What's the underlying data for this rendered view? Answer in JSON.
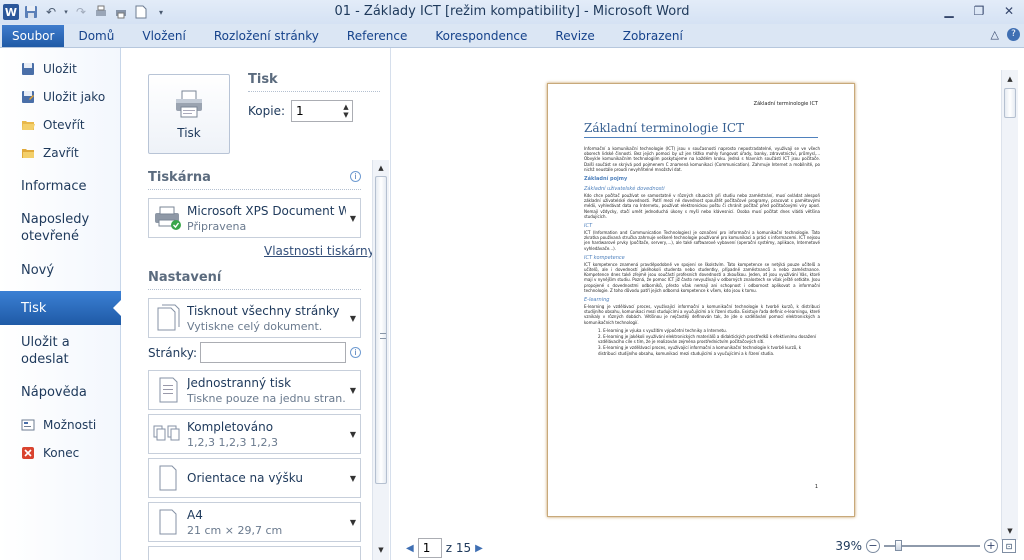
{
  "window": {
    "title": "01 - Základy ICT [režim kompatibility]  -  Microsoft Word",
    "app_icon_letter": "W"
  },
  "ribbon_tabs": [
    "Soubor",
    "Domů",
    "Vložení",
    "Rozložení stránky",
    "Reference",
    "Korespondence",
    "Revize",
    "Zobrazení"
  ],
  "nav": {
    "save": "Uložit",
    "save_as": "Uložit jako",
    "open": "Otevřít",
    "close": "Zavřít",
    "info": "Informace",
    "recent": "Naposledy otevřené",
    "new": "Nový",
    "print": "Tisk",
    "save_send": "Uložit a odeslat",
    "help": "Nápověda",
    "options": "Možnosti",
    "exit": "Konec"
  },
  "print": {
    "section_title": "Tisk",
    "button_label": "Tisk",
    "copies_label": "Kopie:",
    "copies_value": "1"
  },
  "printer": {
    "section_title": "Tiskárna",
    "name": "Microsoft XPS Document W...",
    "status": "Připravena",
    "properties_link": "Vlastnosti tiskárny"
  },
  "settings": {
    "section_title": "Nastavení",
    "pages_label": "Stránky:",
    "pages_value": "",
    "items": [
      {
        "line1": "Tisknout všechny stránky",
        "line2": "Vytiskne celý dokument."
      },
      {
        "line1": "Jednostranný tisk",
        "line2": "Tiskne pouze na jednu stran..."
      },
      {
        "line1": "Kompletováno",
        "line2": "1,2,3    1,2,3    1,2,3"
      },
      {
        "line1": "Orientace na výšku",
        "line2": ""
      },
      {
        "line1": "A4",
        "line2": "21 cm × 29,7 cm"
      }
    ]
  },
  "preview_page": {
    "header": "Základní terminologie ICT",
    "title": "Základní terminologie ICT",
    "intro": "Informační a komunikační technologie (ICT) jsou v současnosti naprosto nepostradatelné, využívají se ve všech oborech lidské činnosti. Bez jejich pomoci by už jen těžko mohly fungovat úřady, banky, zdravotnictví, průmysl,... Obvykle komunikačním technologiím poskytujeme na každém kroku. Jedná s hlavních součástí ICT jsou počítače. Další součást se skrývá pod pojmenem C znamená komunikaci (Communication). Zahrnuje Internet a mobilnítě, po nichž neustále proudí nevyhřitelné množství dat.",
    "h_terms": "Základní pojmy",
    "h_skill": "Základní uživatelské dovednosti",
    "p_skill": "Kdo chce počítač používat se samostatně v různých situacích při studiu nebo zaměstnání, musí ovládat alespoň základní uživatelské dovednosti. Patří mezi ně dovednost spouštět počítačové programy, pracovat s pamětovými médii, vyhledávat data na Internetu, používat elektronickou poštu či chránit počítač před počítačovými viry apod. Nemají vždycky, stačí umět jednoduchá úkony s myší nebo klávesnicí. Osoba musí počítat dnes vládá většina studujících.",
    "h_ict": "ICT",
    "p_ict": "ICT (Information and Communication Technologies) je označení pro informační a komunikační technologie. Tato zkratka používaná stručka zahrnuje veškeré technologie používané pro komunikaci a práci s informacemi. ICT nejsou jen hardwarové prvky (počítače, servery,...), ale také softwarové vybavení (operační systémy, aplikace, Internetové vyhledávače...).",
    "h_comp": "ICT kompetence",
    "p_comp": "ICT kompetence znamená pravděpodobně ve spojení se školstvím. Tato kompetence se netýká pouze učitelů a učitelů, ale i dovedností jakéhokoli studenta nebo studentky, případně zaměstnanců a nebo zaměstnance. Kompetence dnes také zřejmě jsou součástí profesních dovedností a zkouškou. Jeden, ať jsou využívání Vás, ktoré mají v nynějším studiu. Pozná, že pomoc ICT již často nevyužívají v odborných znalostech se však ještě setkáte. Jsou propojené s dovednostmi odborníků, přesto však nemají ani schopnost i odbornost aplikovat a informační technologie. Z toho důvodu patří jejich odborná kompetence k všem, kdo jsou k tomu.",
    "h_elearn": "E-learning",
    "p_elearn": "E-learning je vzdělávací proces, využívající informační a komunikační technologie k tvorbě kurzů, k distribuci studijního obsahu, komunikaci mezi studujícími a vyučujícími a k řízení studia. Existuje řada definic e-learningu, které vznikaly v různých dobách. Většinou je nejčastěji definován tak, že jde o vzdělávání pomocí elektronických a komunikačních technologií.",
    "list": [
      "E-learning je výuka s využitím výpočetní techniky a Internetu.",
      "E-learning je jakékoli využívání elektronických materiálů a didaktických prostředků k efektivnímu dosažení vzdělávacího cíle s tím, že je realizován zejména prostřednictvím počítačových sítí.",
      "E-learning je vzdělávací proces, využívající informační a komunikační technologie k tvorbě kurzů, k distribuci studijního obsahu, komunikaci mezi studujícími a vyučujícími a k řízení studia."
    ],
    "page_number": "1"
  },
  "statusbar": {
    "current_page": "1",
    "of_pages": "z 15",
    "zoom": "39%",
    "zoom_level": 0.39
  },
  "colors": {
    "accent": "#1f5aa6",
    "heading_blue": "#365f91",
    "page_border": "#c8a97a"
  }
}
